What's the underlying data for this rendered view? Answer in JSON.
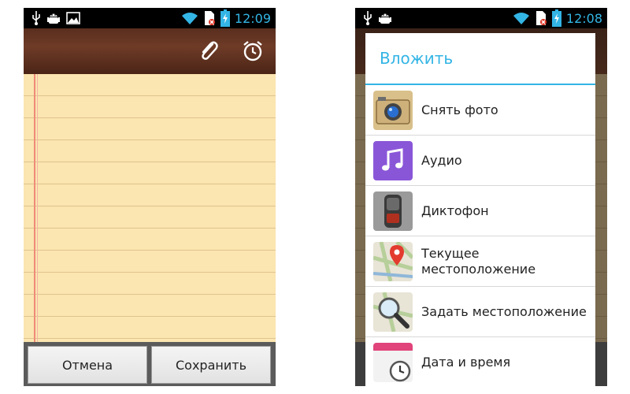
{
  "left_screen": {
    "status_bar": {
      "time": "12:09",
      "left_icons": [
        "usb-icon",
        "android-debug-icon",
        "image-notification-icon"
      ],
      "right_icons": [
        "wifi-icon",
        "sim-missing-icon",
        "battery-charging-icon"
      ]
    },
    "toolbar": {
      "icons": [
        "paperclip-icon",
        "alarm-clock-icon"
      ]
    },
    "buttons": {
      "cancel": "Отмена",
      "save": "Сохранить"
    }
  },
  "right_screen": {
    "status_bar": {
      "time": "12:08",
      "left_icons": [
        "usb-icon",
        "android-debug-icon"
      ],
      "right_icons": [
        "wifi-icon",
        "sim-missing-icon",
        "battery-charging-icon"
      ]
    },
    "dialog": {
      "title": "Вложить",
      "items": [
        {
          "label": "Снять фото",
          "icon": "camera-icon"
        },
        {
          "label": "Аудио",
          "icon": "music-note-icon"
        },
        {
          "label": "Диктофон",
          "icon": "voice-recorder-icon"
        },
        {
          "label": "Текущее\nместоположение",
          "icon": "map-pin-icon"
        },
        {
          "label": "Задать местоположение",
          "icon": "map-search-icon"
        },
        {
          "label": "Дата и время",
          "icon": "calendar-clock-icon"
        }
      ]
    }
  },
  "colors": {
    "accent": "#33b5e5",
    "paper": "#fbe5b0",
    "wood": "#5a2e1e"
  }
}
